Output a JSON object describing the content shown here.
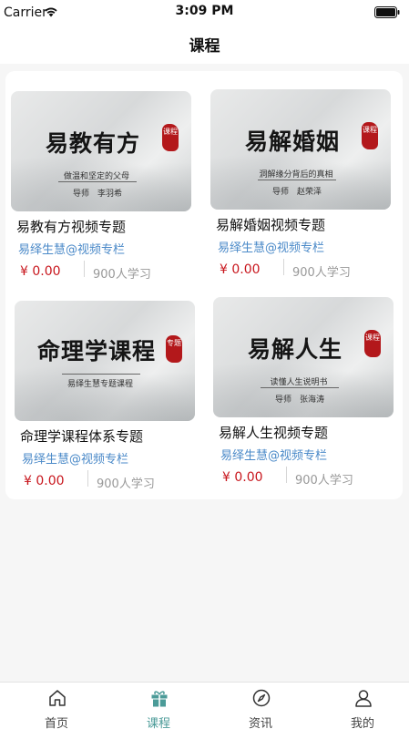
{
  "status_bar": {
    "carrier": "Carrier",
    "time": "3:09 PM"
  },
  "nav": {
    "title": "课程"
  },
  "courses": [
    {
      "thumb_title": "易教有方",
      "thumb_subtitle": "做温和坚定的父母",
      "thumb_teacher": "导师　李羽希",
      "seal_text": "课程",
      "title": "易教有方视频专题",
      "author": "易绎生慧@视频专栏",
      "price": "¥ 0.00",
      "learners": "900人学习"
    },
    {
      "thumb_title": "易解婚姻",
      "thumb_subtitle": "洞解缘分背后的真相",
      "thumb_teacher": "导师　赵荣泽",
      "seal_text": "课程",
      "title": "易解婚姻视频专题",
      "author": "易绎生慧@视频专栏",
      "price": "¥ 0.00",
      "learners": "900人学习"
    },
    {
      "thumb_title": "命理学课程",
      "thumb_subtitle": "易绎生慧专题课程",
      "thumb_teacher": "",
      "seal_text": "专题",
      "title": "命理学课程体系专题",
      "author": "易绎生慧@视频专栏",
      "price": "¥ 0.00",
      "learners": "900人学习"
    },
    {
      "thumb_title": "易解人生",
      "thumb_subtitle": "读懂人生说明书",
      "thumb_teacher": "导师　张海涛",
      "seal_text": "课程",
      "title": "易解人生视频专题",
      "author": "易绎生慧@视频专栏",
      "price": "¥ 0.00",
      "learners": "900人学习"
    }
  ],
  "tabs": [
    {
      "label": "首页",
      "icon": "home-icon",
      "active": false
    },
    {
      "label": "课程",
      "icon": "gift-icon",
      "active": true
    },
    {
      "label": "资讯",
      "icon": "compass-icon",
      "active": false
    },
    {
      "label": "我的",
      "icon": "user-icon",
      "active": false
    }
  ],
  "colors": {
    "accent": "#4b9b98",
    "price": "#c8161d",
    "author": "#4a89c8",
    "seal": "#b3181b"
  }
}
